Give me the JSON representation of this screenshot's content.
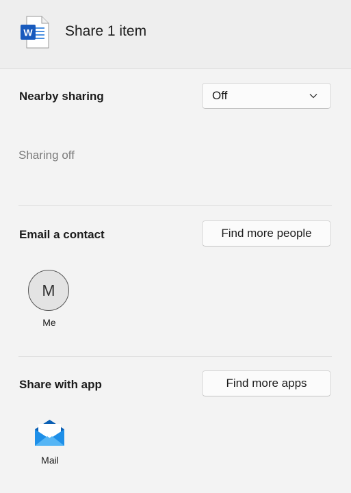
{
  "header": {
    "title": "Share 1 item",
    "file_icon": "word-document-icon",
    "file_icon_badge": "W"
  },
  "nearby_sharing": {
    "label": "Nearby sharing",
    "selected_value": "Off",
    "status": "Sharing off"
  },
  "email_contact": {
    "label": "Email a contact",
    "button_label": "Find more people",
    "contacts": [
      {
        "initial": "M",
        "name": "Me"
      }
    ]
  },
  "share_with_app": {
    "label": "Share with app",
    "button_label": "Find more apps",
    "apps": [
      {
        "name": "Mail",
        "icon": "mail-icon"
      }
    ]
  },
  "colors": {
    "background": "#f3f3f3",
    "header_background": "#eeeeee",
    "word_blue": "#185abd",
    "mail_blue": "#0f78d4"
  }
}
